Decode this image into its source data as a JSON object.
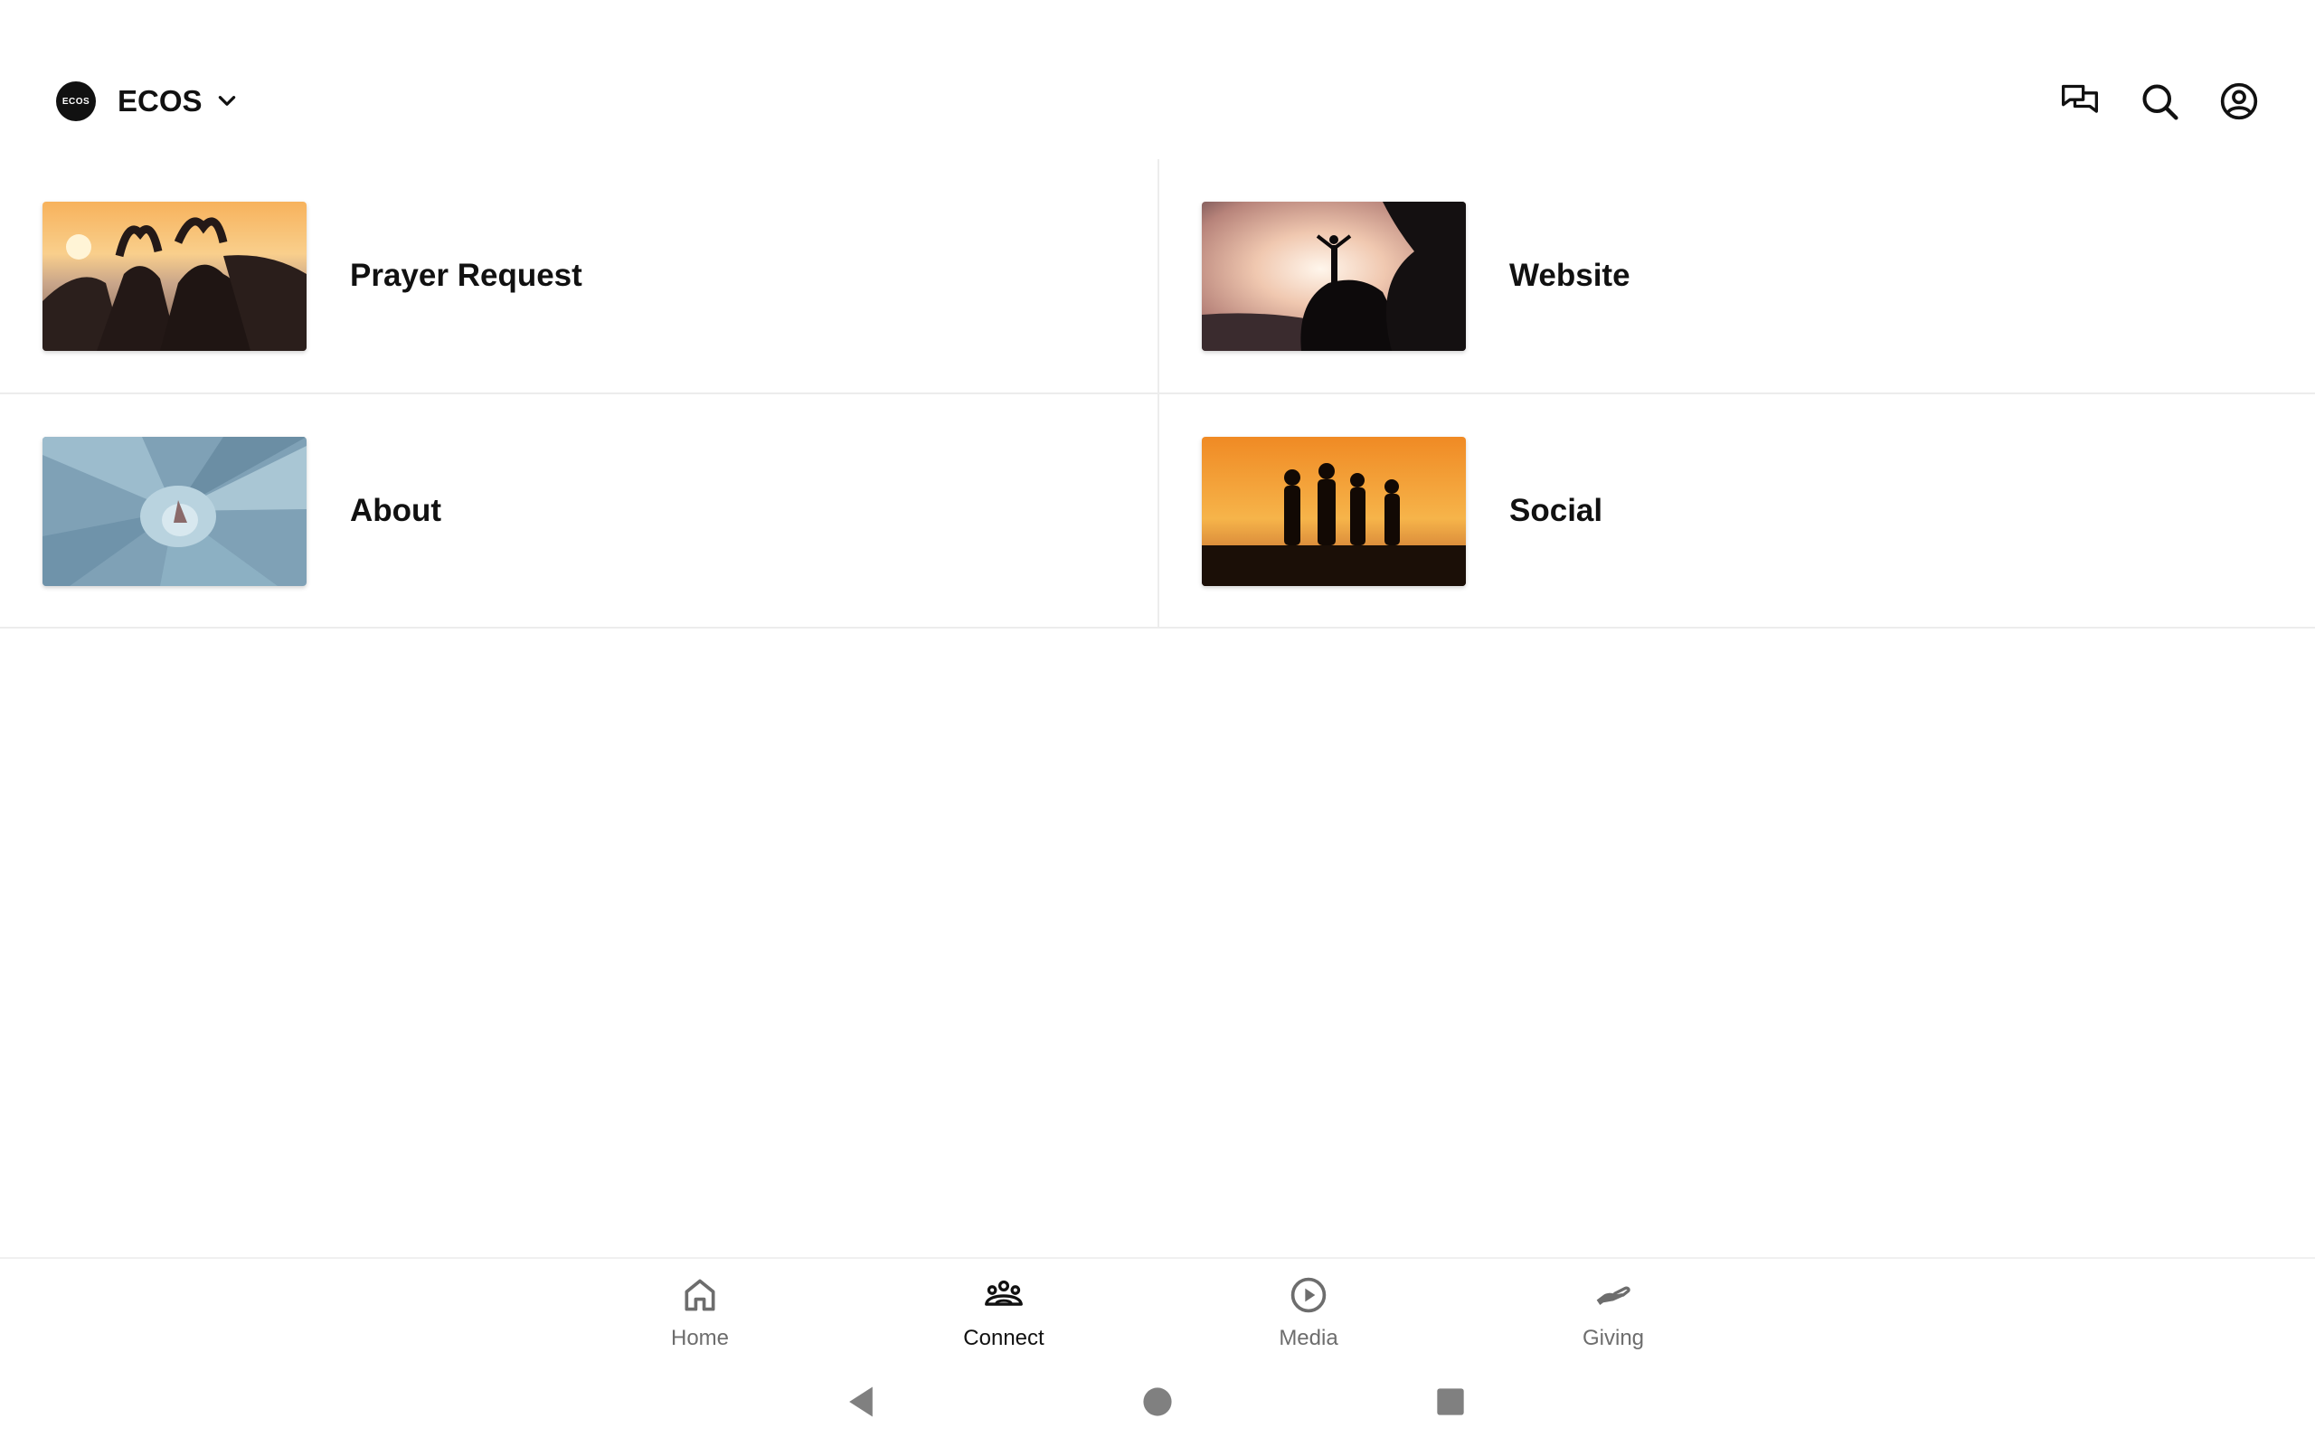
{
  "header": {
    "org_logo_text": "ECOS",
    "org_name": "ECOS",
    "icons": [
      "chevron-down-icon",
      "chat-icon",
      "search-icon",
      "account-icon"
    ]
  },
  "cards": [
    {
      "label": "Prayer Request",
      "image": "people-heart-hands-sunset"
    },
    {
      "label": "Website",
      "image": "person-on-rock-silhouette"
    },
    {
      "label": "About",
      "image": "succulent-plant"
    },
    {
      "label": "Social",
      "image": "group-sunset-silhouette"
    }
  ],
  "bottom_nav": {
    "items": [
      {
        "label": "Home",
        "icon": "home-icon"
      },
      {
        "label": "Connect",
        "icon": "group-icon",
        "active": true
      },
      {
        "label": "Media",
        "icon": "play-circle-icon"
      },
      {
        "label": "Giving",
        "icon": "giving-hand-icon"
      }
    ]
  },
  "system_nav": [
    "back-icon",
    "home-circle-icon",
    "recents-icon"
  ],
  "colors": {
    "background": "#ffffff",
    "text": "#111111",
    "divider": "#ececec",
    "nav_inactive": "#6d6d6d"
  }
}
